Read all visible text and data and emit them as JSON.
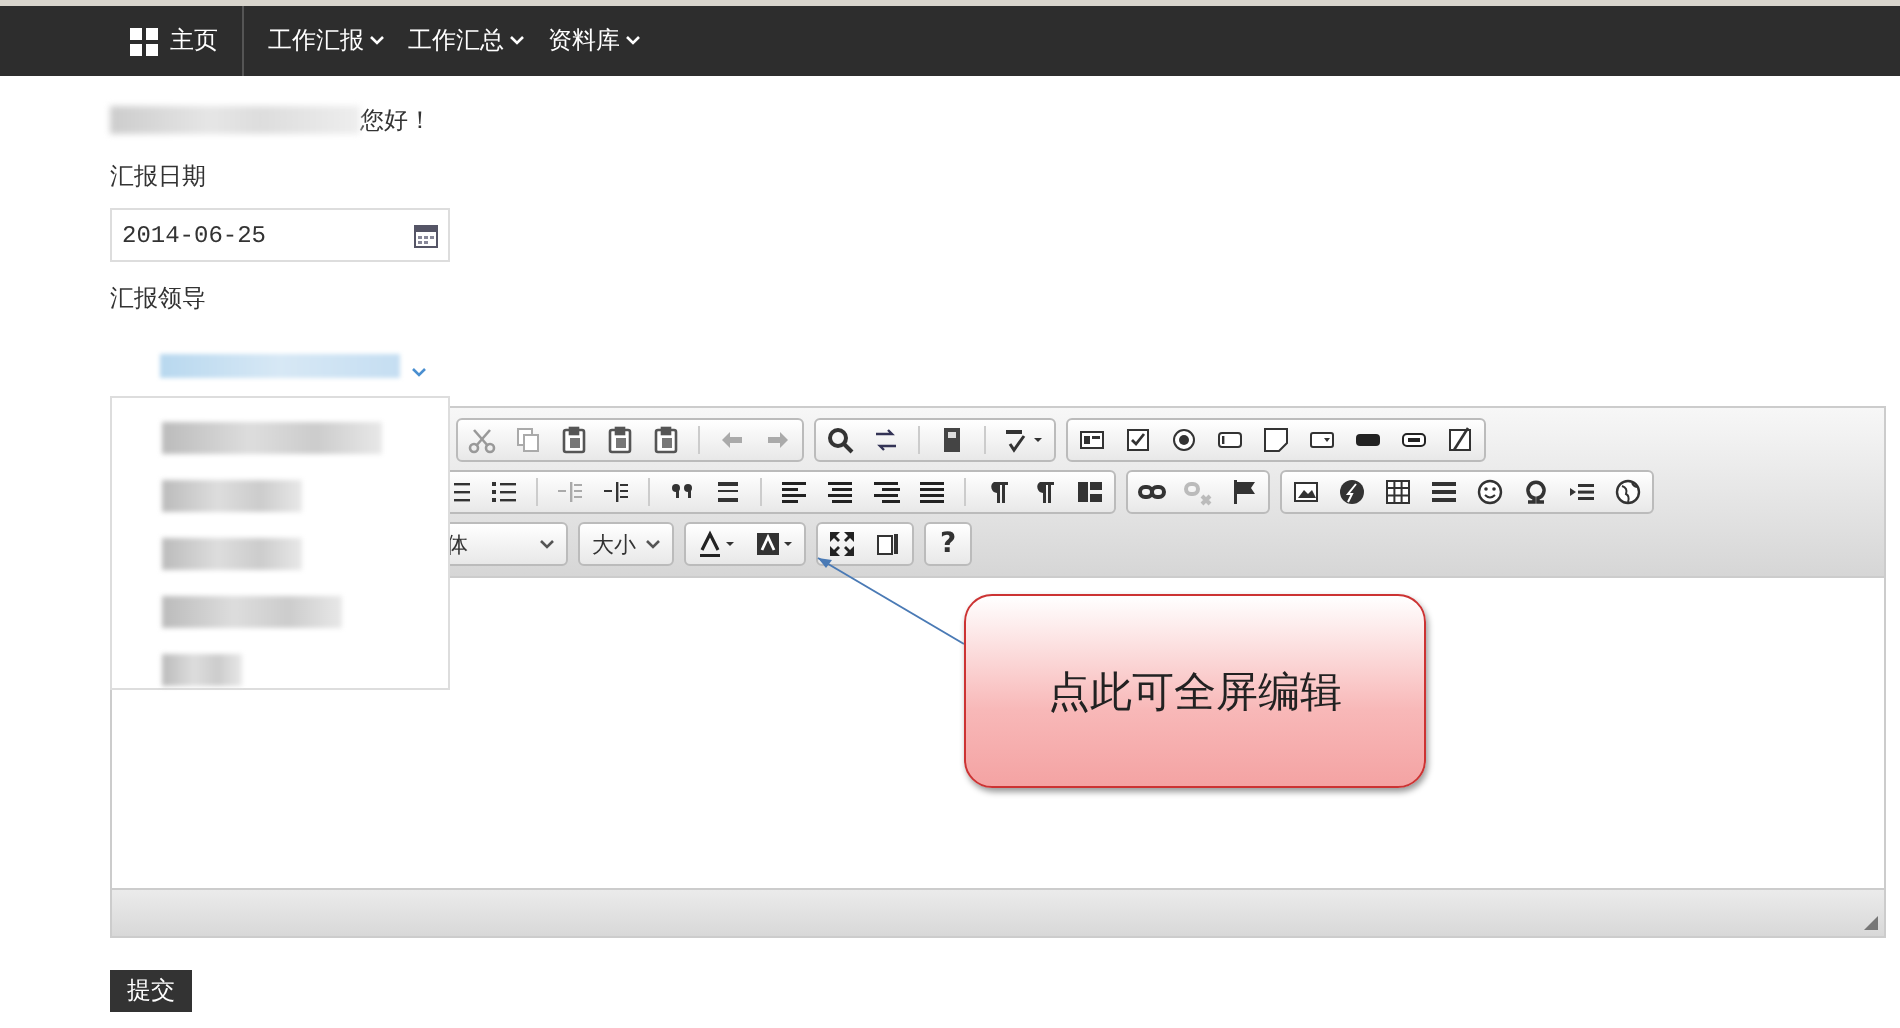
{
  "navbar": {
    "home": "主页",
    "menus": [
      {
        "label": "工作汇报"
      },
      {
        "label": "工作汇总"
      },
      {
        "label": "资料库"
      }
    ]
  },
  "greeting": {
    "suffix": "您好！"
  },
  "form": {
    "date_label": "汇报日期",
    "date_value": "2014-06-25",
    "leader_label": "汇报领导",
    "leader_expanded": true,
    "leader_options": [
      {
        "kind": "blurred"
      },
      {
        "kind": "blurred"
      },
      {
        "kind": "blurred"
      },
      {
        "kind": "blurred"
      },
      {
        "kind": "blurred"
      }
    ]
  },
  "editor": {
    "font_select": "体",
    "size_select": "大小",
    "help": "?"
  },
  "callout": "点此可全屏编辑",
  "submit": "提交"
}
